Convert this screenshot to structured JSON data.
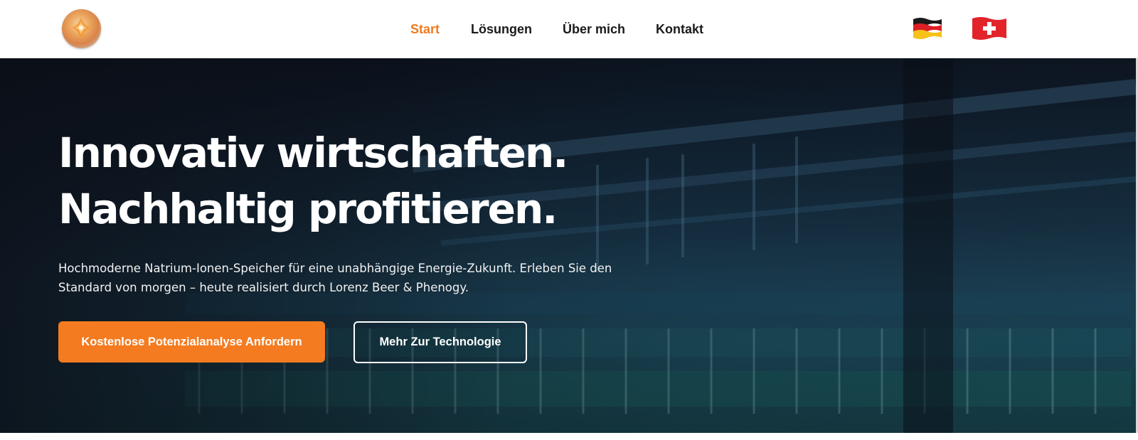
{
  "header": {
    "nav": [
      {
        "label": "Start",
        "active": true
      },
      {
        "label": "Lösungen",
        "active": false
      },
      {
        "label": "Über mich",
        "active": false
      },
      {
        "label": "Kontakt",
        "active": false
      }
    ],
    "languages": [
      {
        "icon": "germany-flag-icon"
      },
      {
        "icon": "switzerland-flag-icon"
      }
    ]
  },
  "hero": {
    "headline_line1": "Innovativ wirtschaften.",
    "headline_line2": "Nachhaltig profitieren.",
    "subtext": "Hochmoderne Natrium-Ionen-Speicher für eine unabhängige Energie-Zukunft. Erleben Sie den Standard von morgen – heute realisiert durch Lorenz Beer & Phenogy.",
    "primary_button": "Kostenlose Potenzialanalyse Anfordern",
    "secondary_button": "Mehr Zur Technologie"
  },
  "colors": {
    "accent": "#f47b20",
    "nav_active": "#f07a1f",
    "hero_dark": "#0d1624",
    "hero_teal": "#164a5e"
  }
}
